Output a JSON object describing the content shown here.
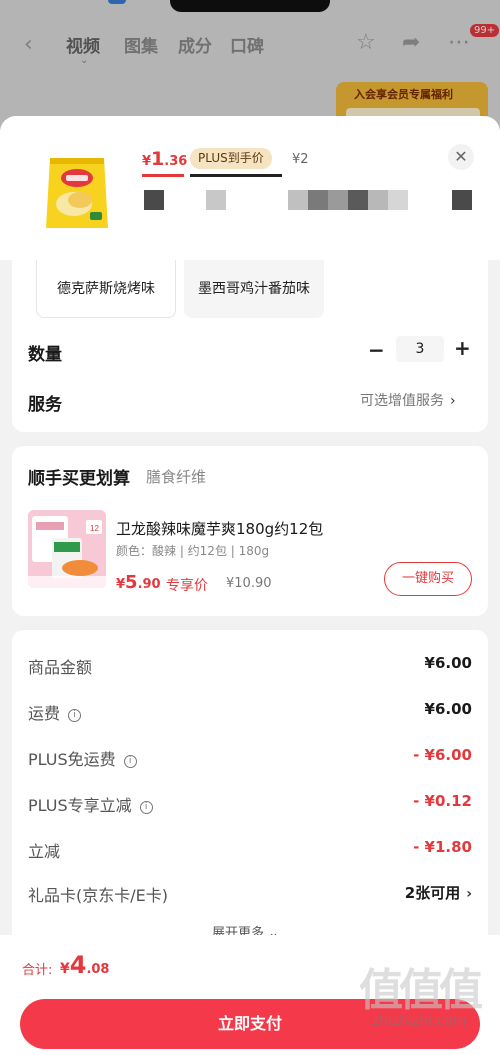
{
  "background": {
    "tabs": [
      "视频",
      "图集",
      "成分",
      "口碑"
    ],
    "badge": "99+",
    "banner_text": "入会享会员专属福利"
  },
  "product": {
    "price_currency": "¥",
    "price_int": "1",
    "price_dec": ".36",
    "plus_tag": "PLUS到手价",
    "original_price": "¥2"
  },
  "spec": {
    "options": [
      "德克萨斯烧烤味",
      "墨西哥鸡汁番茄味"
    ],
    "quantity_label": "数量",
    "quantity_value": "3",
    "service_label": "服务",
    "service_link": "可选增值服务"
  },
  "addon": {
    "title": "顺手买更划算",
    "subtitle": "膳食纤维",
    "name": "卫龙酸辣味魔芋爽180g约12包",
    "spec": "颜色：酸辣 | 约12包 | 180g",
    "price_currency": "¥",
    "price_int": "5",
    "price_dec": ".90",
    "price_tag": "专享价",
    "original_price": "¥10.90",
    "buy_button": "一键购买"
  },
  "summary": {
    "rows": [
      {
        "label": "商品金额",
        "value": "¥6.00",
        "info": false,
        "red": false
      },
      {
        "label": "运费",
        "value": "¥6.00",
        "info": true,
        "red": false
      },
      {
        "label": "PLUS免运费",
        "value": "- ¥6.00",
        "info": true,
        "red": true
      },
      {
        "label": "PLUS专享立减",
        "value": "- ¥0.12",
        "info": true,
        "red": true
      },
      {
        "label": "立减",
        "value": "- ¥1.80",
        "info": false,
        "red": true
      },
      {
        "label": "礼品卡(京东卡/E卡)",
        "value": "2张可用",
        "info": false,
        "red": false
      }
    ],
    "expand_more": "展开更多"
  },
  "footer": {
    "total_label": "合计:",
    "total_currency": "¥",
    "total_int": "4",
    "total_dec": ".08",
    "pay_button": "立即支付",
    "watermark_site": "zhizhizhi.com",
    "watermark_logo": "值值值"
  }
}
